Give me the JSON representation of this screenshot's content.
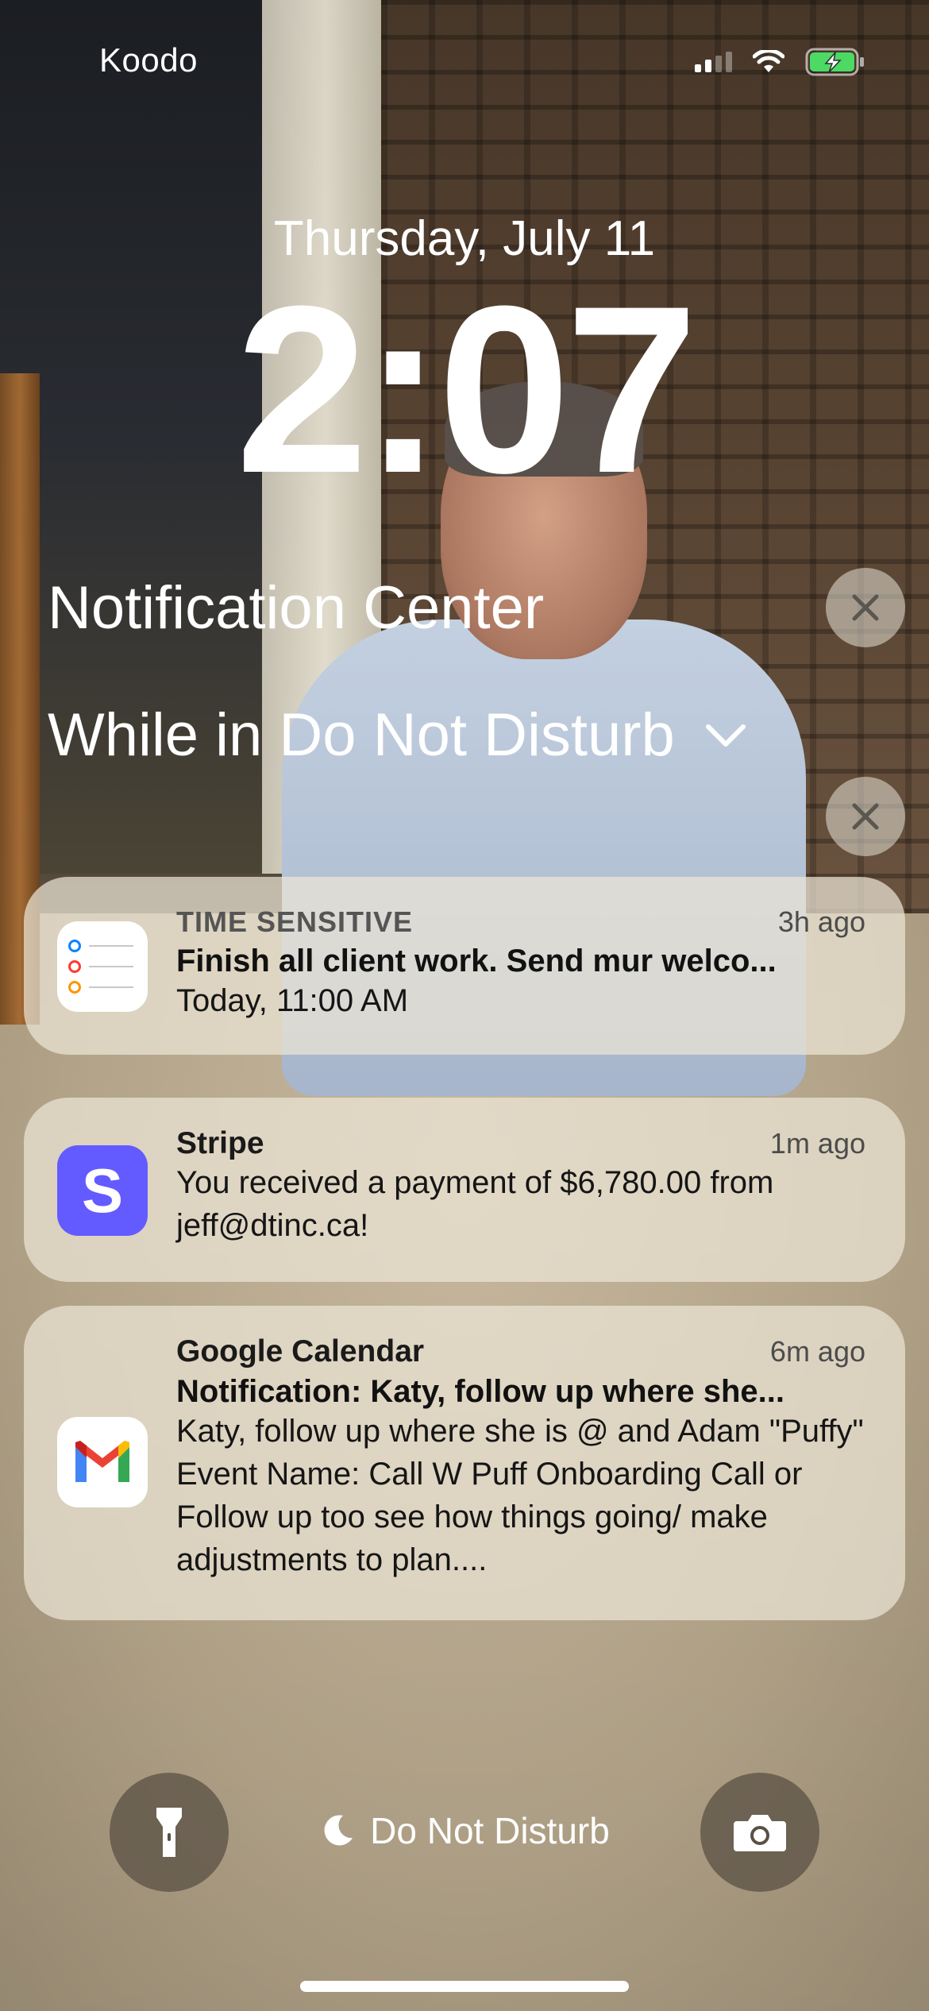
{
  "status_bar": {
    "carrier": "Koodo",
    "signal_icon": "cellular-signal-icon",
    "wifi_icon": "wifi-icon",
    "battery_icon": "battery-charging-icon",
    "battery_color": "#4cd964"
  },
  "lock_screen": {
    "date": "Thursday, July 11",
    "time": "2:07"
  },
  "notification_center": {
    "title": "Notification Center",
    "focus_group_title": "While in Do Not Disturb"
  },
  "notifications": [
    {
      "app_icon": "reminders-icon",
      "app_name": "TIME SENSITIVE",
      "time_ago": "3h ago",
      "title": "Finish all client work. Send mur welco...",
      "body": "Today, 11:00 AM"
    },
    {
      "app_icon": "stripe-icon",
      "icon_letter": "S",
      "app_name": "Stripe",
      "time_ago": "1m ago",
      "body": "You received a payment of $6,780.00 from jeff@dtinc.ca!",
      "brand_color": "#635bff"
    },
    {
      "app_icon": "gmail-icon",
      "app_name": "Google Calendar",
      "time_ago": "6m ago",
      "title": "Notification: Katy, follow up where she...",
      "body": "Katy, follow up where she is @ and Adam \"Puffy\" Event Name: Call W Puff Onboarding Call or Follow up too see how things going/ make adjustments to plan...."
    }
  ],
  "bottom_bar": {
    "flashlight_icon": "flashlight-icon",
    "focus_icon": "moon-icon",
    "focus_label": "Do Not Disturb",
    "camera_icon": "camera-icon"
  }
}
